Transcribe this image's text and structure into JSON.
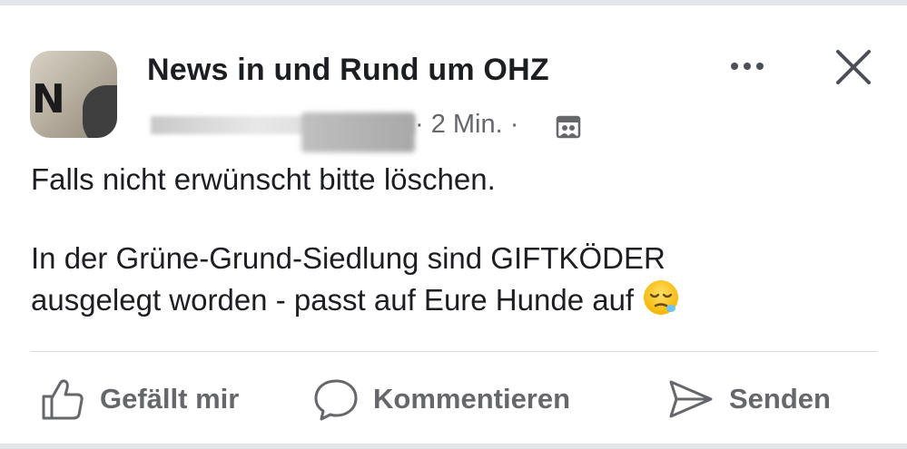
{
  "post": {
    "page_name": "News in und Rund um OHZ",
    "avatar_letters": "N",
    "meta": "· 2 Min. ·",
    "privacy_icon": "group-icon",
    "text_line_1": "Falls nicht erwünscht bitte löschen.",
    "text_line_2": "In der Grüne-Grund-Siedlung sind GIFTKÖDER",
    "text_line_3": "ausgelegt worden - passt auf Eure Hunde auf",
    "emoji": "sleepy-face-emoji"
  },
  "actions": {
    "like_label": "Gefällt mir",
    "comment_label": "Kommentieren",
    "share_label": "Senden"
  },
  "icons": {
    "more": "more-horizontal-icon",
    "close": "close-icon",
    "like": "thumbs-up-icon",
    "comment": "comment-bubble-icon",
    "share": "send-arrow-icon"
  },
  "colors": {
    "text_primary": "#1c1e21",
    "text_secondary": "#65676b",
    "divider": "#d8dadf",
    "background": "#e4e6eb",
    "card": "#ffffff"
  }
}
